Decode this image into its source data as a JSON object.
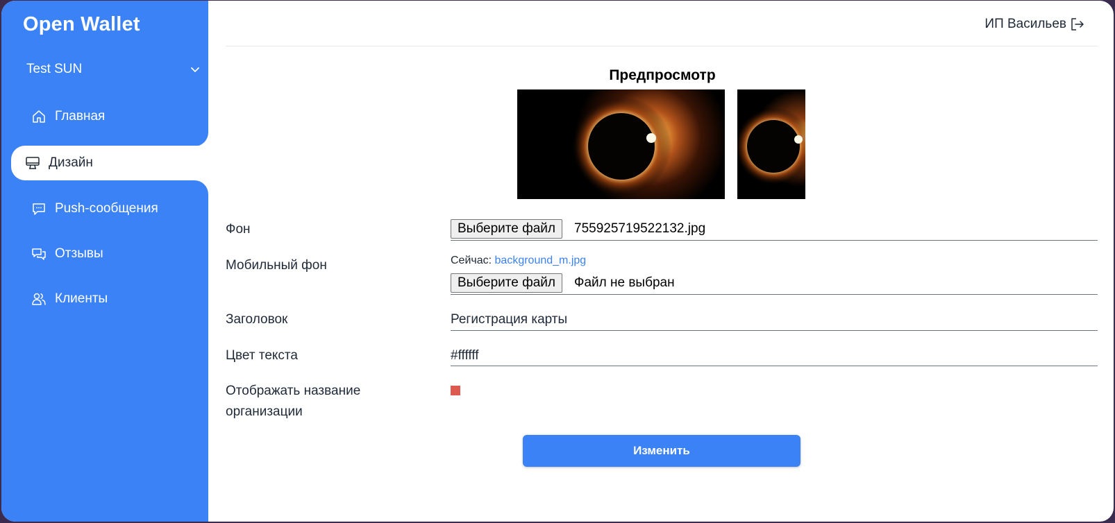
{
  "app": {
    "brand": "Open Wallet"
  },
  "sidebar": {
    "org_select": "Test SUN",
    "items": [
      {
        "label": "Главная",
        "icon": "home-icon"
      },
      {
        "label": "Дизайн",
        "icon": "monitor-icon",
        "active": true
      },
      {
        "label": "Push-сообщения",
        "icon": "message-icon"
      },
      {
        "label": "Отзывы",
        "icon": "chat-icon"
      },
      {
        "label": "Клиенты",
        "icon": "users-icon"
      }
    ]
  },
  "header": {
    "user_name": "ИП Васильев",
    "logout_icon": "logout-icon"
  },
  "preview": {
    "title": "Предпросмотр"
  },
  "form": {
    "background": {
      "label": "Фон",
      "button": "Выберите файл",
      "file_name": "755925719522132.jpg"
    },
    "mobile_background": {
      "label": "Мобильный фон",
      "current_prefix": "Сейчас:",
      "current_file": "background_m.jpg",
      "button": "Выберите файл",
      "file_name": "Файл не выбран"
    },
    "title": {
      "label": "Заголовок",
      "value": "Регистрация карты"
    },
    "text_color": {
      "label": "Цвет текста",
      "value": "#ffffff"
    },
    "show_org_name": {
      "label_line1": "Отображать название",
      "label_line2": "организации",
      "checked": true
    },
    "submit": "Изменить"
  },
  "colors": {
    "accent": "#3b82f6",
    "checkbox": "#dc5a50",
    "sidebar_text": "#ffffff"
  }
}
